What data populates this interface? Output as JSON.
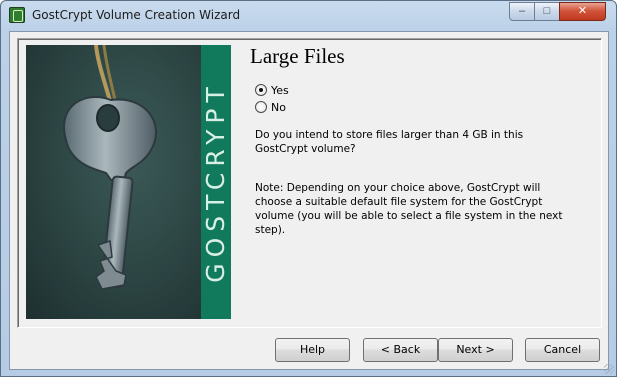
{
  "window": {
    "title": "GostCrypt Volume Creation Wizard",
    "min_glyph": "–",
    "max_glyph": "□",
    "close_glyph": "✕"
  },
  "sidebar": {
    "brand": "GOSTCRYPT",
    "image": "key-photo"
  },
  "page": {
    "title": "Large Files",
    "options": [
      {
        "label": "Yes",
        "checked": true
      },
      {
        "label": "No",
        "checked": false
      }
    ],
    "question": "Do you intend to store files larger than 4 GB in this GostCrypt volume?",
    "note": "Note: Depending on your choice above, GostCrypt will choose a suitable default file system for the GostCrypt volume (you will be able to select a file system in the next step)."
  },
  "buttons": {
    "help": "Help",
    "back": "< Back",
    "next": "Next >",
    "cancel": "Cancel"
  },
  "colors": {
    "brand_strip": "#127a5c",
    "brand_text": "#d8efe5"
  }
}
